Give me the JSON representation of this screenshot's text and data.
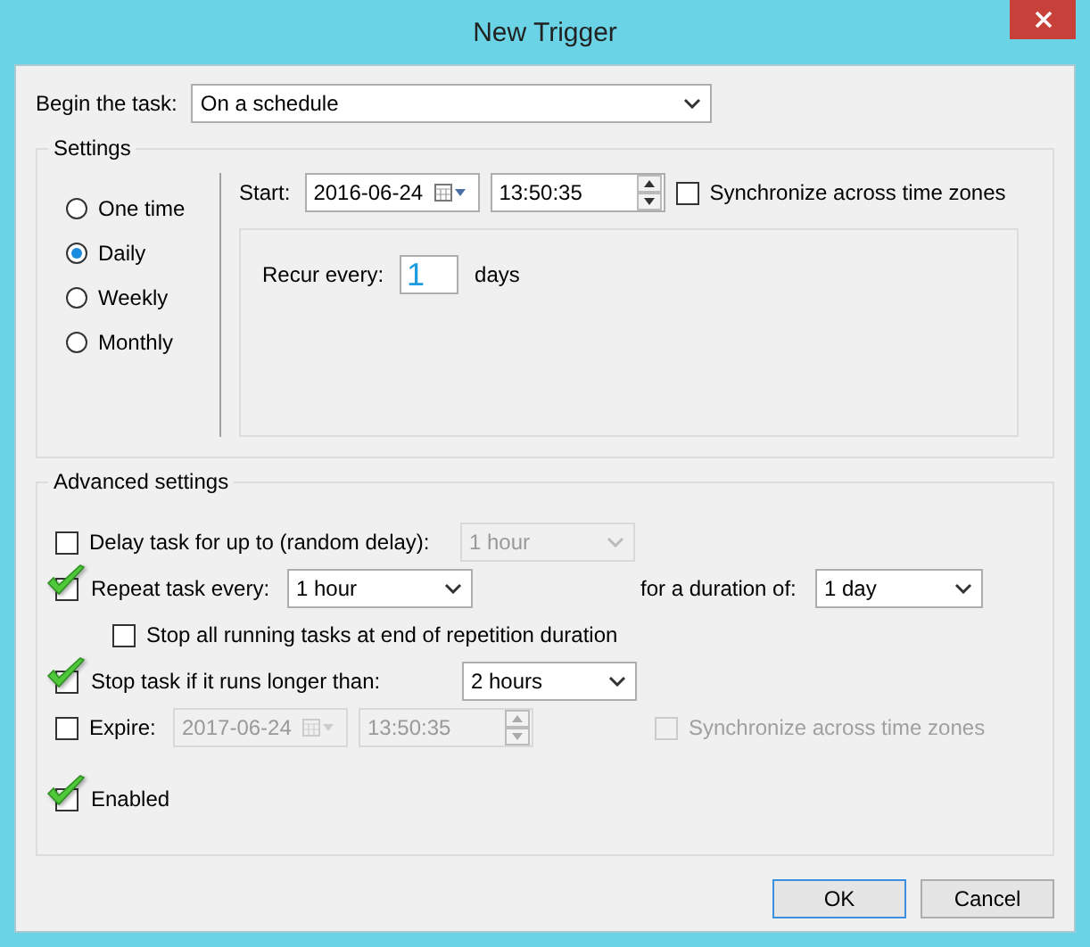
{
  "window": {
    "title": "New Trigger"
  },
  "begin": {
    "label": "Begin the task:",
    "value": "On a schedule"
  },
  "settings": {
    "title": "Settings",
    "schedules": [
      {
        "label": "One time",
        "selected": false
      },
      {
        "label": "Daily",
        "selected": true
      },
      {
        "label": "Weekly",
        "selected": false
      },
      {
        "label": "Monthly",
        "selected": false
      }
    ],
    "start": {
      "label": "Start:",
      "date": "2016-06-24",
      "time": "13:50:35"
    },
    "sync": {
      "label": "Synchronize across time zones",
      "checked": false
    },
    "recur": {
      "label": "Recur every:",
      "value": "1",
      "unit": "days"
    }
  },
  "advanced": {
    "title": "Advanced settings",
    "delay": {
      "label": "Delay task for up to (random delay):",
      "checked": false,
      "value": "1 hour",
      "disabled": true
    },
    "repeat": {
      "label": "Repeat task every:",
      "checked": true,
      "value": "1 hour",
      "duration_label": "for a duration of:",
      "duration": "1 day"
    },
    "stop_all": {
      "label": "Stop all running tasks at end of repetition duration",
      "checked": false
    },
    "stop_longer": {
      "label": "Stop task if it runs longer than:",
      "checked": true,
      "value": "2 hours"
    },
    "expire": {
      "label": "Expire:",
      "checked": false,
      "date": "2017-06-24",
      "time": "13:50:35",
      "disabled": true
    },
    "expire_sync": {
      "label": "Synchronize across time zones",
      "checked": false,
      "disabled": true
    },
    "enabled": {
      "label": "Enabled",
      "checked": true
    }
  },
  "buttons": [
    {
      "label": "OK",
      "default": true
    },
    {
      "label": "Cancel",
      "default": false
    }
  ]
}
